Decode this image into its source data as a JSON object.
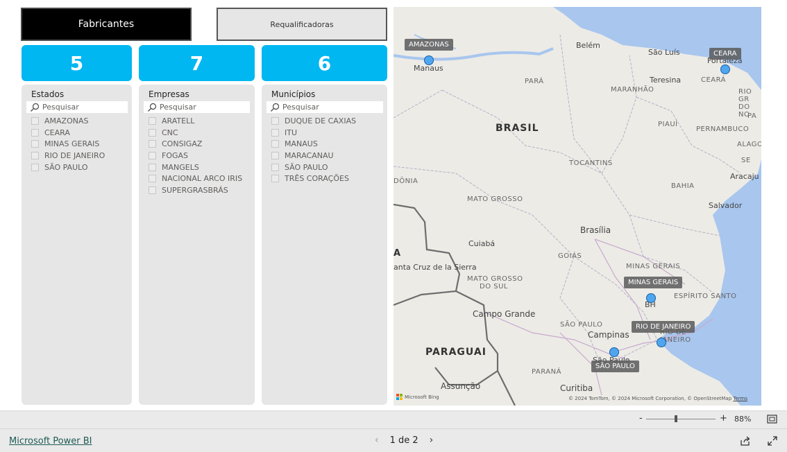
{
  "tabs": {
    "fabricantes": "Fabricantes",
    "requalificadoras": "Requalificadoras"
  },
  "kpis": {
    "estados": "5",
    "empresas": "7",
    "municipios": "6"
  },
  "panels": {
    "estados": {
      "title": "Estados",
      "search_placeholder": "Pesquisar",
      "items": [
        "AMAZONAS",
        "CEARA",
        "MINAS GERAIS",
        "RIO DE JANEIRO",
        "SÃO PAULO"
      ]
    },
    "empresas": {
      "title": "Empresas",
      "search_placeholder": "Pesquisar",
      "items": [
        "ARATELL",
        "CNC",
        "CONSIGAZ",
        "FOGAS",
        "MANGELS",
        "NACIONAL ARCO IRIS",
        "SUPERGRASBRÁS"
      ]
    },
    "municipios": {
      "title": "Municípios",
      "search_placeholder": "Pesquisar",
      "items": [
        "DUQUE DE CAXIAS",
        "ITU",
        "MANAUS",
        "MARACANAU",
        "SÃO PAULO",
        "TRÊS CORAÇÕES"
      ]
    }
  },
  "map": {
    "markers": [
      "AMAZONAS",
      "CEARA",
      "MINAS GERAIS",
      "RIO DE JANEIRO",
      "SÃO PAULO"
    ],
    "labels": {
      "belem": "Belém",
      "sao_luis": "São Luís",
      "fortaleza": "Fortaleza",
      "manaus": "Manaus",
      "para": "PARÁ",
      "maranhao": "MARANHÃO",
      "teresina": "Teresina",
      "ceara_state": "CEARÁ",
      "rio_grande_norte": "RIO GR DO NO",
      "paraiba": "PA",
      "piaui": "PIAUÍ",
      "pernambuco": "PERNAMBUCO",
      "alagoas": "ALAGOAS",
      "sergipe": "SE",
      "aracaju": "Aracaju",
      "brasil": "BRASIL",
      "tocantins": "TOCANTINS",
      "bahia": "BAHIA",
      "salvador": "Salvador",
      "rondonia": "DÔNIA",
      "mato_grosso": "MATO GROSSO",
      "brasilia": "Brasília",
      "cuiaba": "Cuiabá",
      "goias": "GOIÁS",
      "santa_cruz": "anta Cruz de la Sierra",
      "bolivia_part": "A",
      "minas_gerais_state": "MINAS GERAIS",
      "ms1": "MATO GROSSO",
      "ms2": "DO SUL",
      "bh": "BH",
      "espirito_santo": "ESPÍRITO SANTO",
      "campo_grande": "Campo Grande",
      "sao_paulo_state": "SÃO PAULO",
      "campinas": "Campinas",
      "rio_state": "RIO DE JANEIRO",
      "sao_paulo_city": "São Paulo",
      "paraguai": "PARAGUAI",
      "parana": "PARANÁ",
      "assuncao": "Assunção",
      "curitiba": "Curitiba"
    },
    "copyright": "© 2024 TomTom, © 2024 Microsoft Corporation, © OpenStreetMap",
    "terms": "Terms",
    "bing": "Microsoft Bing"
  },
  "zoom": {
    "level": "88%",
    "minus": "-",
    "plus": "+"
  },
  "footer": {
    "brand": "Microsoft Power BI",
    "page": "1 de 2",
    "prev": "‹",
    "next": "›"
  },
  "colors": {
    "accent": "#00b7f1",
    "panel": "#e6e6e6",
    "pin": "#4fa6ee",
    "water": "#a8c6ee"
  }
}
